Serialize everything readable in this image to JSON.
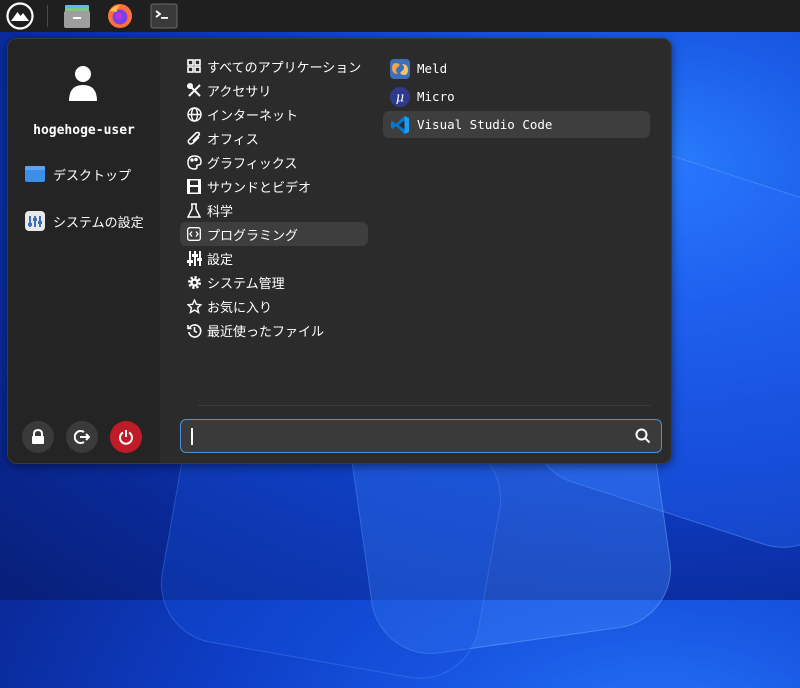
{
  "user": {
    "name": "hogehoge-user"
  },
  "sidebar": {
    "items": [
      {
        "label": "デスクトップ",
        "icon": "desktop-folder-icon"
      },
      {
        "label": "システムの設定",
        "icon": "settings-manager-icon"
      }
    ],
    "actions": [
      {
        "icon": "lock-icon"
      },
      {
        "icon": "logout-icon"
      },
      {
        "icon": "power-icon"
      }
    ]
  },
  "categories": [
    {
      "label": "すべてのアプリケーション",
      "icon": "grid-icon"
    },
    {
      "label": "アクセサリ",
      "icon": "tools-icon"
    },
    {
      "label": "インターネット",
      "icon": "globe-icon"
    },
    {
      "label": "オフィス",
      "icon": "paperclip-icon"
    },
    {
      "label": "グラフィックス",
      "icon": "palette-icon"
    },
    {
      "label": "サウンドとビデオ",
      "icon": "film-icon"
    },
    {
      "label": "科学",
      "icon": "flask-icon"
    },
    {
      "label": "プログラミング",
      "icon": "code-icon",
      "selected": true
    },
    {
      "label": "設定",
      "icon": "sliders-icon"
    },
    {
      "label": "システム管理",
      "icon": "gear-icon"
    },
    {
      "label": "お気に入り",
      "icon": "star-icon"
    },
    {
      "label": "最近使ったファイル",
      "icon": "history-icon"
    }
  ],
  "apps": [
    {
      "label": "Meld",
      "icon": "meld-icon"
    },
    {
      "label": "Micro",
      "icon": "micro-icon"
    },
    {
      "label": "Visual Studio Code",
      "icon": "vscode-icon",
      "selected": true
    }
  ],
  "search": {
    "value": "",
    "placeholder": ""
  },
  "colors": {
    "accent": "#4a90d9",
    "power": "#c01c28",
    "menu_bg": "#2b2b2b",
    "panel_bg": "#1f1f1f"
  }
}
